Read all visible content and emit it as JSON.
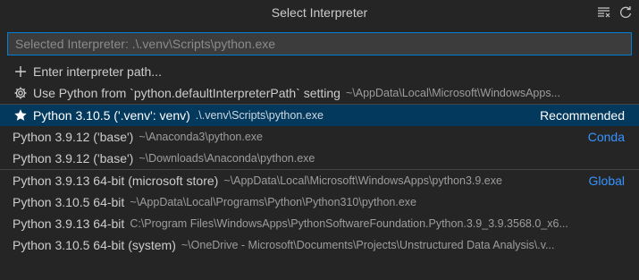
{
  "title": "Select Interpreter",
  "title_actions": [
    {
      "icon": "clear-all-icon"
    },
    {
      "icon": "refresh-icon"
    }
  ],
  "search": {
    "value": "",
    "placeholder": "Selected Interpreter: .\\.venv\\Scripts\\python.exe"
  },
  "actions": [
    {
      "icon": "plus-icon",
      "label": "Enter interpreter path...",
      "description": ""
    },
    {
      "icon": "gear-icon",
      "label": "Use Python from `python.defaultInterpreterPath` setting",
      "description": "~\\AppData\\Local\\Microsoft\\WindowsApps..."
    }
  ],
  "recommended": {
    "icon": "star-icon",
    "label": "Python 3.10.5 ('.venv': venv)",
    "description": ".\\.venv\\Scripts\\python.exe",
    "badge": "Recommended"
  },
  "conda": [
    {
      "label": "Python 3.9.12 ('base')",
      "description": "~\\Anaconda3\\python.exe",
      "badge": "Conda"
    },
    {
      "label": "Python 3.9.12 ('base')",
      "description": "~\\Downloads\\Anaconda\\python.exe",
      "badge": ""
    }
  ],
  "global": [
    {
      "label": "Python 3.9.13 64-bit (microsoft store)",
      "description": "~\\AppData\\Local\\Microsoft\\WindowsApps\\python3.9.exe",
      "badge": "Global"
    },
    {
      "label": "Python 3.10.5 64-bit",
      "description": "~\\AppData\\Local\\Programs\\Python\\Python310\\python.exe",
      "badge": ""
    },
    {
      "label": "Python 3.9.13 64-bit",
      "description": "C:\\Program Files\\WindowsApps\\PythonSoftwareFoundation.Python.3.9_3.9.3568.0_x6...",
      "badge": ""
    },
    {
      "label": "Python 3.10.5 64-bit (system)",
      "description": "~\\OneDrive - Microsoft\\Documents\\Projects\\Unstructured Data Analysis\\.v...",
      "badge": ""
    }
  ],
  "colors": {
    "background": "#252526",
    "selection": "#04395e",
    "focus_border": "#007fd4",
    "badge_blue": "#3794ff"
  }
}
